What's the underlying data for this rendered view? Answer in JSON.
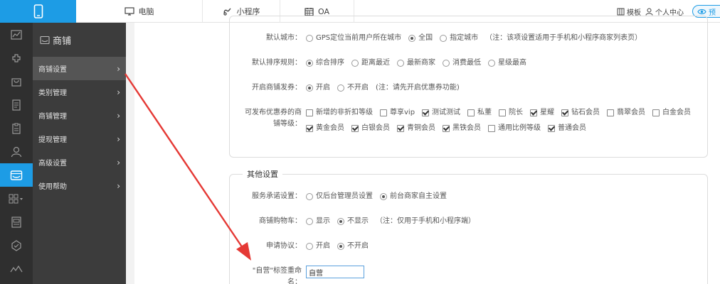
{
  "topbar": {
    "tabs": [
      {
        "label": "电脑",
        "icon": "monitor-icon"
      },
      {
        "label": "小程序",
        "icon": "miniprogram-icon"
      },
      {
        "label": "OA",
        "icon": "calendar-icon"
      }
    ],
    "right": {
      "template_label": "模板",
      "user_center_label": "个人中心",
      "preview_label": "预"
    }
  },
  "rail": {
    "icons": [
      "chart-icon",
      "puzzle-icon",
      "bag-icon",
      "document-icon",
      "clipboard-icon",
      "user-icon",
      "shop-icon",
      "grid-icon",
      "report-icon",
      "badge-icon",
      "signal-icon"
    ],
    "active_index": 6
  },
  "sidebar": {
    "title": "商铺",
    "items": [
      {
        "label": "商铺设置",
        "active": true
      },
      {
        "label": "类别管理"
      },
      {
        "label": "商铺管理"
      },
      {
        "label": "提现管理"
      },
      {
        "label": "高级设置"
      },
      {
        "label": "使用帮助"
      }
    ]
  },
  "settings": {
    "default_city": {
      "label": "默认城市：",
      "options": [
        "GPS定位当前用户所在城市",
        "全国",
        "指定城市"
      ],
      "selected": 1,
      "note": "（注：该项设置适用于手机和小程序商家列表页）"
    },
    "default_sort": {
      "label": "默认排序规则：",
      "options": [
        "综合排序",
        "距离最近",
        "最新商家",
        "消费最低",
        "星级最高"
      ],
      "selected": 0
    },
    "shop_coupon": {
      "label": "开启商铺发券：",
      "options": [
        "开启",
        "不开启"
      ],
      "selected": 0,
      "note": "(注：请先开启优惠券功能)"
    },
    "coupon_levels": {
      "label_line1": "可发布优惠券的商",
      "label_line2": "铺等级：",
      "options": [
        {
          "label": "新增的非折扣等级",
          "checked": false
        },
        {
          "label": "尊享vip",
          "checked": false
        },
        {
          "label": "测试测试",
          "checked": true
        },
        {
          "label": "私董",
          "checked": false
        },
        {
          "label": "院长",
          "checked": false
        },
        {
          "label": "星耀",
          "checked": true
        },
        {
          "label": "钻石会员",
          "checked": true
        },
        {
          "label": "翡翠会员",
          "checked": false
        },
        {
          "label": "白金会员",
          "checked": false
        },
        {
          "label": "黄金会员",
          "checked": true
        },
        {
          "label": "白银会员",
          "checked": true
        },
        {
          "label": "青铜会员",
          "checked": true
        },
        {
          "label": "黑铁会员",
          "checked": true
        },
        {
          "label": "通用比例等级",
          "checked": false
        },
        {
          "label": "普通会员",
          "checked": true
        }
      ]
    }
  },
  "other_settings": {
    "title": "其他设置",
    "service_promise": {
      "label": "服务承诺设置：",
      "options": [
        "仅后台管理员设置",
        "前台商家自主设置"
      ],
      "selected": 1
    },
    "shop_cart": {
      "label": "商铺购物车：",
      "options": [
        "显示",
        "不显示"
      ],
      "selected": 1,
      "note": "（注：仅用于手机和小程序端）"
    },
    "apply_agreement": {
      "label": "申请协议：",
      "options": [
        "开启",
        "不开启"
      ],
      "selected": 1
    },
    "self_tag_rename": {
      "label_line1": "\"自营\"标签重命",
      "label_line2": "名：",
      "value": "自营"
    }
  },
  "colors": {
    "accent": "#1d9ce5",
    "annotation_arrow": "#e53935"
  }
}
